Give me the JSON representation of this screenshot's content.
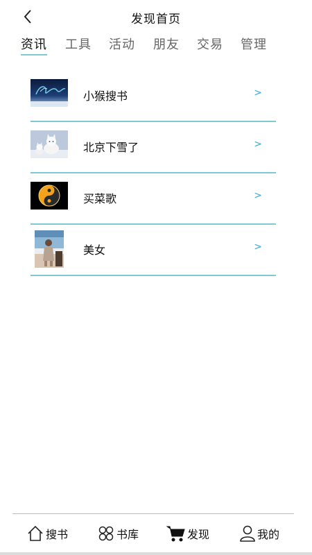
{
  "header": {
    "title": "发现首页"
  },
  "tabs": [
    {
      "label": "资讯",
      "active": true
    },
    {
      "label": "工具"
    },
    {
      "label": "活动"
    },
    {
      "label": "朋友"
    },
    {
      "label": "交易"
    },
    {
      "label": "管理"
    }
  ],
  "list": [
    {
      "label": "小猴搜书",
      "arrow": ">",
      "thumb": "dragon-night-image"
    },
    {
      "label": "北京下雪了",
      "arrow": ">",
      "thumb": "white-cats-image"
    },
    {
      "label": "买菜歌",
      "arrow": ">",
      "thumb": "yin-yang-image"
    },
    {
      "label": "美女",
      "arrow": ">",
      "thumb": "woman-image"
    }
  ],
  "nav": [
    {
      "label": "搜书",
      "icon": "home-icon"
    },
    {
      "label": "书库",
      "icon": "clover-icon"
    },
    {
      "label": "发现",
      "icon": "cart-icon"
    },
    {
      "label": "我的",
      "icon": "user-icon"
    }
  ],
  "colors": {
    "accent": "#7ec9d6",
    "arrow": "#3ea6d6",
    "divider": "#bdbdbd"
  }
}
